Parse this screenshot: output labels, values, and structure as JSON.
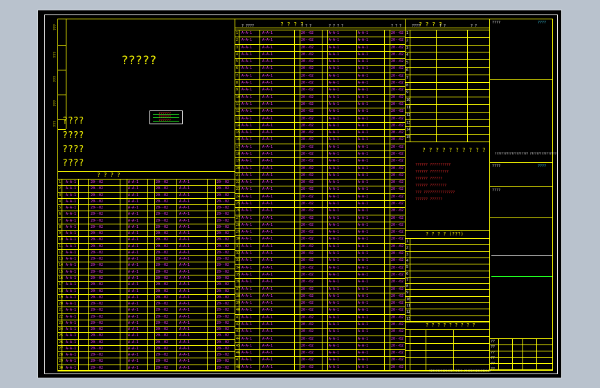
{
  "drawing": {
    "main_title": "?????",
    "title_block_label": "????",
    "left_notes": [
      "????",
      "????",
      "????",
      "????"
    ],
    "legend_box_lines": [
      "??????",
      "??????",
      "??????"
    ]
  },
  "tables": {
    "bottom_left": {
      "heading": "?  ?  ?  ?",
      "row_count": 30,
      "rows_text": [
        "A-A-1",
        "20--02",
        "A-A-1",
        "20--02"
      ]
    },
    "top_middle": {
      "heading": "?   ?   ?   ?",
      "header_cells": [
        "?  ????",
        "?  ?  ?",
        "?  ?  ?  ?",
        "?  ?  ?"
      ],
      "row_count": 48
    },
    "top_right": {
      "heading": "?   ?   ?   ?",
      "header_cells": [
        "????",
        "?  ?",
        "?  ?"
      ]
    },
    "right_notes": {
      "heading": "? ? ? ? ? ? ? ? ? ?",
      "lines": [
        "?????? ??????????",
        "?????? ?????????",
        "?????? ??????",
        "?????? ????????",
        "??? ???????????????",
        "?????? ??????"
      ]
    },
    "right_middle": {
      "heading": "?   ?   ?   ? (???)"
    },
    "right_bottom": {
      "heading": "? ? ? ? ? ? ? ? ?"
    }
  },
  "title_block": {
    "sections": [
      "????",
      "????",
      "????",
      "????"
    ],
    "approval_labels": [
      "??",
      "??",
      "??",
      "??",
      "??",
      "??"
    ],
    "footer_text": "???????????????????? ????????????????"
  },
  "colors": {
    "background_frame": "#b9c2cd",
    "canvas": "#000000",
    "lines": "#ffff00",
    "text_primary": "#ffff00",
    "text_secondary": "#ff40ff",
    "accent_red": "#ff3030",
    "accent_cyan": "#40e0ff"
  }
}
